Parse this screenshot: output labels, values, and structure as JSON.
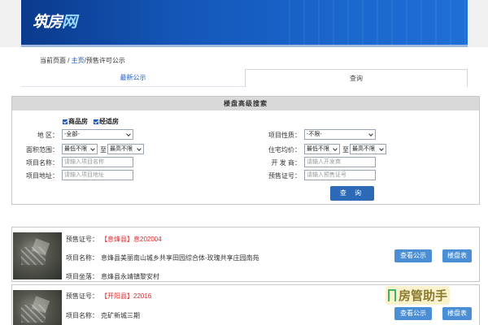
{
  "header": {
    "logo_main": "筑房",
    "logo_accent": "网"
  },
  "breadcrumb": {
    "prefix": "当前页面 / ",
    "home": "主页",
    "current": "/预售许可公示"
  },
  "tabs": [
    {
      "label": "最新公示"
    },
    {
      "label": "查询"
    }
  ],
  "search": {
    "title": "楼盘高级搜索",
    "checkboxes": [
      {
        "label": "商品房",
        "checked": true
      },
      {
        "label": "经适房",
        "checked": true
      }
    ],
    "fields": {
      "district": {
        "label": "地  区：",
        "value": "-全部-"
      },
      "area": {
        "label": "面积范围：",
        "min": "最低不限",
        "to": "至",
        "max": "最高不限"
      },
      "name": {
        "label": "项目名称：",
        "placeholder": "请输入项目名称"
      },
      "address": {
        "label": "项目地址：",
        "placeholder": "请输入项目地址"
      },
      "nature": {
        "label": "项目性质：",
        "value": "-不限-"
      },
      "price": {
        "label": "住宅均价：",
        "min": "最低不限",
        "to": "至",
        "max": "最高不限"
      },
      "developer": {
        "label": "开 发 商：",
        "placeholder": "请输入开发商"
      },
      "permit": {
        "label": "预售证号：",
        "placeholder": "请输入预售证号"
      }
    },
    "query_label": "查 询"
  },
  "results": [
    {
      "permit_label": "预售证号：",
      "permit_value": "【息烽县】息202004",
      "name_label": "项目名称：",
      "name_value": "息烽县美丽南山城乡共享田园综合体-玫瑰共享庄园南苑",
      "location_label": "项目坐落：",
      "location_value": "息烽县永靖镇黎安村",
      "buttons": {
        "view": "查看公示",
        "table": "楼盘表"
      }
    },
    {
      "permit_label": "预售证号：",
      "permit_value": "【开阳县】22016",
      "name_label": "项目名称：",
      "name_value": "克矿新城三期",
      "buttons": {
        "view": "查看公示",
        "table": "楼盘表"
      }
    }
  ],
  "watermark": {
    "text": "房管助手"
  }
}
